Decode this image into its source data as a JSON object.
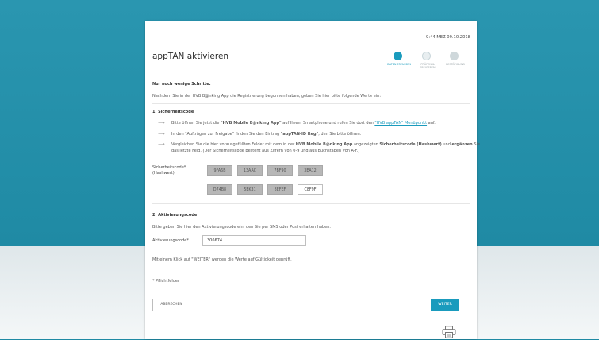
{
  "timestamp": "9:44 MEZ 09.10.2018",
  "title": "appTAN aktivieren",
  "steps": [
    {
      "label": "DATEN ERFASSEN",
      "state": "active"
    },
    {
      "label": "PRÜFEN & FREIGEBEN",
      "state": "todo"
    },
    {
      "label": "BESTÄTIGUNG",
      "state": "todo"
    }
  ],
  "intro_heading": "Nur noch wenige Schritte:",
  "intro_text": "Nachdem Sie in der HVB B@nking App die Registrierung begonnen haben, geben Sie hier bitte folgende Werte ein:",
  "section1": {
    "heading": "1. Sicherheitscode",
    "line1_pre": "Bitte öffnen Sie jetzt die ",
    "line1_bold": "\"HVB Mobile B@nking App\"",
    "line1_mid": " auf Ihrem Smartphone und rufen Sie dort den ",
    "line1_link": "\"HVB appTAN\" Menüpunkt",
    "line1_post": " auf.",
    "line2_pre": "In den \"Aufträgen zur Freigabe\" finden Sie den Eintrag ",
    "line2_bold": "\"appTAN-ID Reg\"",
    "line2_post": ", den Sie bitte öffnen.",
    "line3_pre": "Vergleichen Sie die hier vorausgefüllten Felder mit dem in der ",
    "line3_bold1": "HVB Mobile B@nking App",
    "line3_mid": " angezeigten ",
    "line3_bold2": "Sicherheitscode (Hashwert)",
    "line3_mid2": " und ",
    "line3_bold3": "ergänzen",
    "line3_post": " Sie",
    "line3_b": "das letzte Feld. (Der Sicherheitscode besteht aus Ziffern von 0-9 und aus Buchstaben von A-F.)",
    "field_label": "Sicherheitscode*",
    "field_sublabel": "(Hashwert)",
    "codes_row1": [
      "9FA6B",
      "13AAC",
      "7BF90",
      "3EA12"
    ],
    "codes_row2": [
      "D74B8",
      "5EK31",
      "8EFEF",
      "C8F9F"
    ]
  },
  "section2": {
    "heading": "2. Aktivierungscode",
    "text": "Bitte geben Sie hier den Aktivierungscode ein, den Sie per SMS oder Post erhalten haben.",
    "field_label": "Aktivierungscode*",
    "field_value": "306674"
  },
  "hint": "Mit einem Klick auf \"WEITER\" werden die Werte auf Gültigkeit geprüft.",
  "required_note": "* Pflichtfelder",
  "buttons": {
    "cancel": "ABBRECHEN",
    "next": "WEITER"
  },
  "colors": {
    "accent": "#1a9bbd",
    "background": "#1f8aa4"
  },
  "icons": {
    "print": "printer-icon"
  }
}
